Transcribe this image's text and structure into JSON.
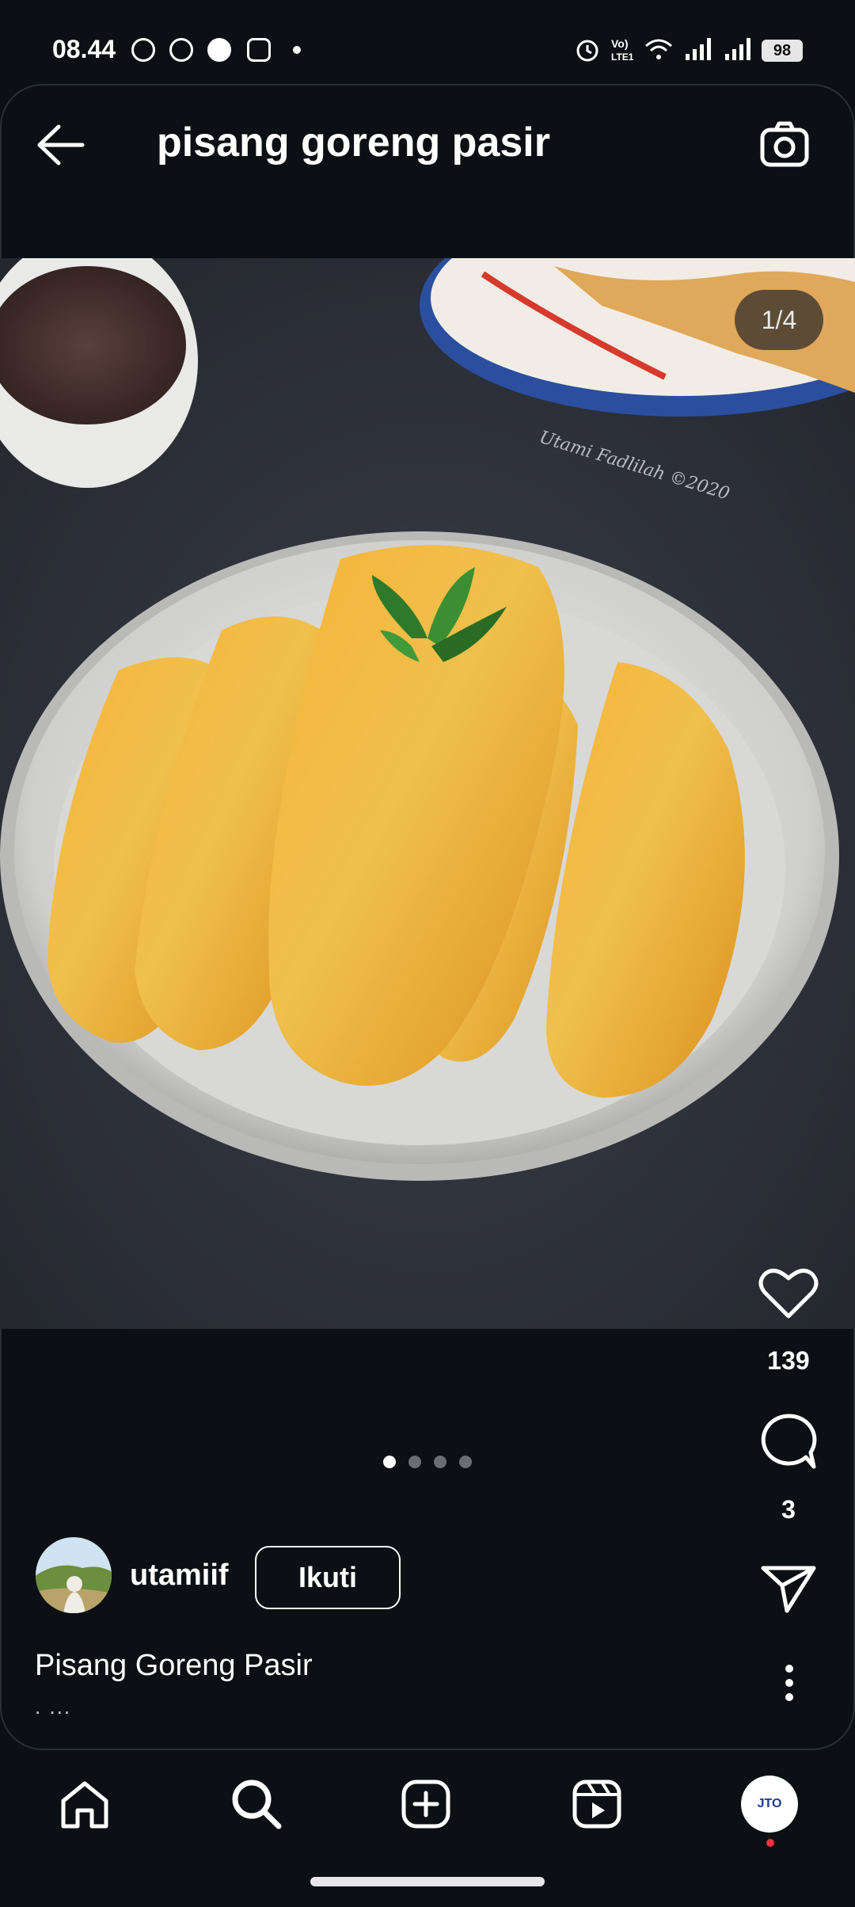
{
  "status_bar": {
    "time": "08.44",
    "battery": "98"
  },
  "header": {
    "title": "pisang goreng pasir"
  },
  "post": {
    "image_counter": "1/4",
    "watermark": "Utami Fadlilah ©2020",
    "likes": "139",
    "comments": "3",
    "username": "utamiif",
    "follow_label": "Ikuti",
    "caption": "Pisang Goreng Pasir",
    "caption_more": ". ..."
  },
  "bottom_nav": {
    "profile_badge": "JTO"
  }
}
